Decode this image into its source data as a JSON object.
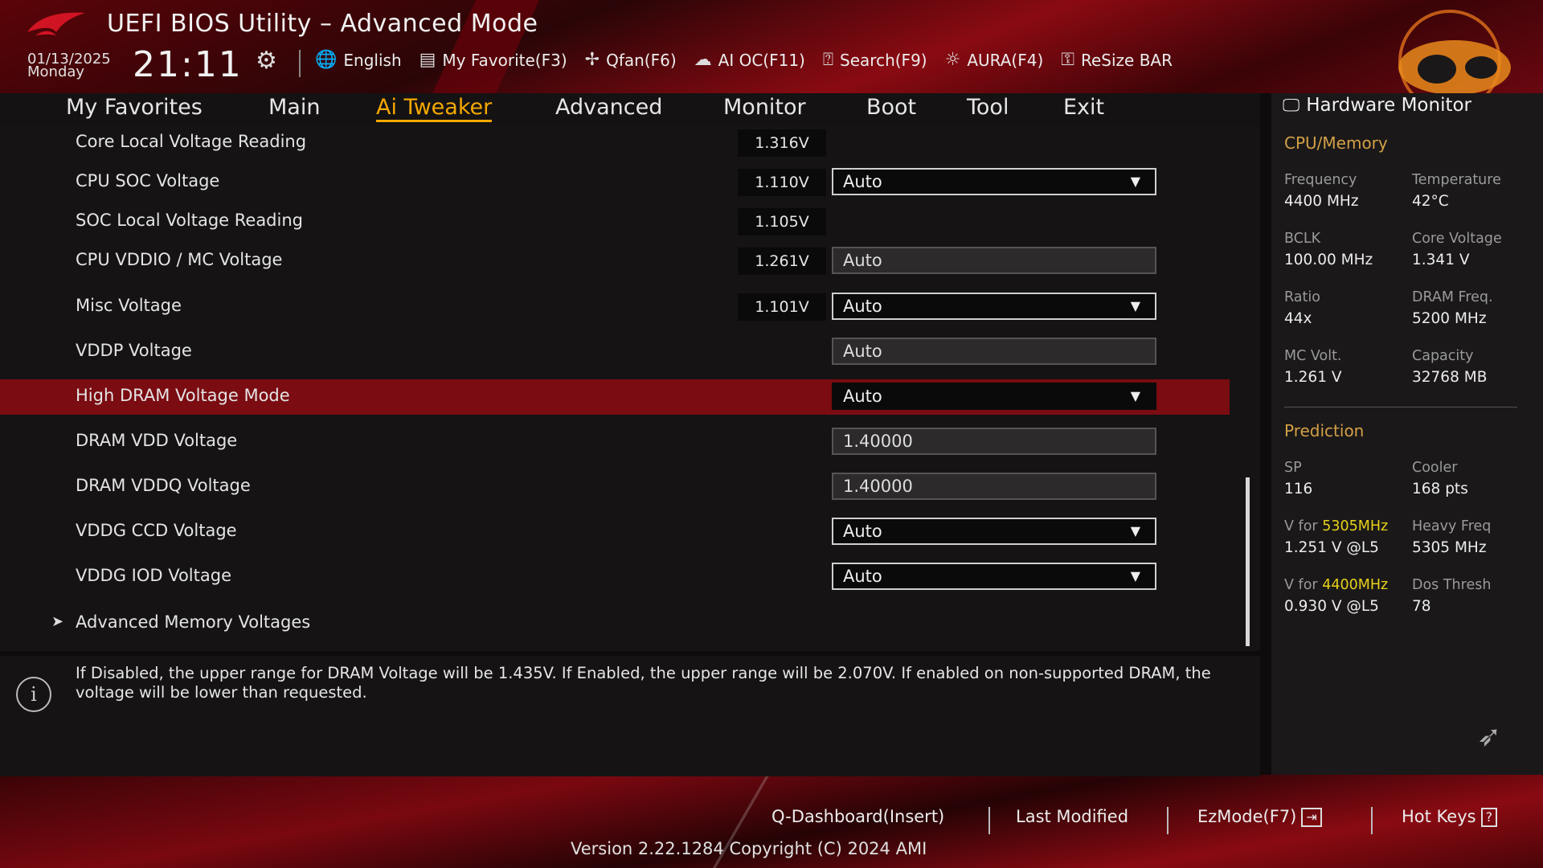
{
  "header": {
    "title": "UEFI BIOS Utility – Advanced Mode",
    "date": "01/13/2025",
    "day": "Monday",
    "time": "21:11",
    "toolbar": [
      {
        "icon": "globe-icon",
        "label": "English"
      },
      {
        "icon": "favorite-icon",
        "label": "My Favorite(F3)"
      },
      {
        "icon": "fan-icon",
        "label": "Qfan(F6)"
      },
      {
        "icon": "ai-oc-icon",
        "label": "AI OC(F11)"
      },
      {
        "icon": "search-icon",
        "label": "Search(F9)"
      },
      {
        "icon": "aura-icon",
        "label": "AURA(F4)"
      },
      {
        "icon": "resize-bar-icon",
        "label": "ReSize BAR"
      }
    ]
  },
  "tabs": [
    {
      "label": "My Favorites",
      "active": false
    },
    {
      "label": "Main",
      "active": false
    },
    {
      "label": "Ai Tweaker",
      "active": true
    },
    {
      "label": "Advanced",
      "active": false
    },
    {
      "label": "Monitor",
      "active": false
    },
    {
      "label": "Boot",
      "active": false
    },
    {
      "label": "Tool",
      "active": false
    },
    {
      "label": "Exit",
      "active": false
    }
  ],
  "settings": [
    {
      "label": "Core Local Voltage Reading",
      "reading": "1.316V",
      "control": null
    },
    {
      "label": "CPU SOC Voltage",
      "reading": "1.110V",
      "control": {
        "type": "dropdown",
        "value": "Auto"
      }
    },
    {
      "label": "SOC Local Voltage Reading",
      "reading": "1.105V",
      "control": null
    },
    {
      "label": "CPU VDDIO / MC Voltage",
      "reading": "1.261V",
      "control": {
        "type": "readonly",
        "value": "Auto"
      }
    },
    {
      "label": "Misc Voltage",
      "reading": "1.101V",
      "control": {
        "type": "dropdown",
        "value": "Auto"
      }
    },
    {
      "label": "VDDP Voltage",
      "reading": null,
      "control": {
        "type": "readonly",
        "value": "Auto"
      }
    },
    {
      "label": "High DRAM Voltage Mode",
      "reading": null,
      "control": {
        "type": "dropdown",
        "value": "Auto"
      },
      "selected": true
    },
    {
      "label": "DRAM VDD Voltage",
      "reading": null,
      "control": {
        "type": "readonly",
        "value": "1.40000"
      }
    },
    {
      "label": "DRAM VDDQ Voltage",
      "reading": null,
      "control": {
        "type": "readonly",
        "value": "1.40000"
      }
    },
    {
      "label": "VDDG CCD Voltage",
      "reading": null,
      "control": {
        "type": "dropdown",
        "value": "Auto"
      }
    },
    {
      "label": "VDDG IOD Voltage",
      "reading": null,
      "control": {
        "type": "dropdown",
        "value": "Auto"
      }
    },
    {
      "label": "Advanced Memory Voltages",
      "reading": null,
      "control": null,
      "submenu": true
    }
  ],
  "help": {
    "text": "If Disabled, the upper range for DRAM Voltage will be 1.435V. If Enabled, the upper range will be 2.070V. If enabled on non-supported DRAM, the voltage will be lower than requested."
  },
  "hardware_monitor": {
    "title": "Hardware Monitor",
    "cpu_memory": {
      "heading": "CPU/Memory",
      "frequency_label": "Frequency",
      "frequency": "4400 MHz",
      "temperature_label": "Temperature",
      "temperature": "42°C",
      "bclk_label": "BCLK",
      "bclk": "100.00 MHz",
      "core_voltage_label": "Core Voltage",
      "core_voltage": "1.341 V",
      "ratio_label": "Ratio",
      "ratio": "44x",
      "dram_freq_label": "DRAM Freq.",
      "dram_freq": "5200 MHz",
      "mc_volt_label": "MC Volt.",
      "mc_volt": "1.261 V",
      "capacity_label": "Capacity",
      "capacity": "32768 MB"
    },
    "prediction": {
      "heading": "Prediction",
      "sp_label": "SP",
      "sp": "116",
      "cooler_label": "Cooler",
      "cooler": "168 pts",
      "v_for_label": "V for",
      "v_for_1_freq": "5305MHz",
      "v_for_1": "1.251 V @L5",
      "heavy_freq_label": "Heavy Freq",
      "heavy_freq": "5305 MHz",
      "v_for_2_freq": "4400MHz",
      "v_for_2": "0.930 V @L5",
      "dos_thresh_label": "Dos Thresh",
      "dos_thresh": "78"
    }
  },
  "footer": {
    "q_dashboard": "Q-Dashboard(Insert)",
    "last_modified": "Last Modified",
    "ezmode": "EzMode(F7)",
    "hotkeys": "Hot Keys",
    "version": "Version 2.22.1284 Copyright (C) 2024 AMI"
  },
  "colors": {
    "accent": "#f5a800",
    "selected_row": "#7a0c12",
    "section_heading": "#d3a046",
    "highlight_freq": "#e7d21a"
  }
}
